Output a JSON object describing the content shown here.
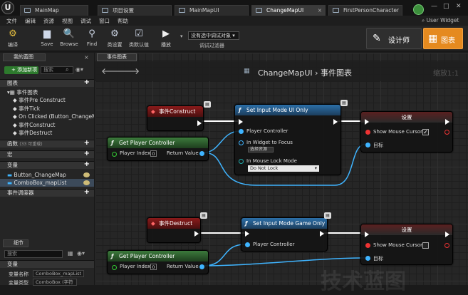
{
  "tabs": [
    {
      "label": "MainMap"
    },
    {
      "label": "项目设置"
    },
    {
      "label": "MainMapUI"
    },
    {
      "label": "ChangeMapUI"
    },
    {
      "label": "FirstPersonCharacter"
    }
  ],
  "menu": [
    "文件",
    "编辑",
    "资源",
    "视图",
    "调试",
    "窗口",
    "帮助"
  ],
  "search_help": "User Widget",
  "toolbar": {
    "compile": "编译",
    "save": "Save",
    "browse": "Browse",
    "find": "Find",
    "class_settings": "类设置",
    "class_defaults": "类默认值",
    "play": "播放",
    "debug_object": "没有选中调试对象",
    "debug_filter": "调试过滤器",
    "designer": "设计师",
    "graph": "图表"
  },
  "left_panel": {
    "tab": "我的蓝图",
    "add_new": "添加新项",
    "search_placeholder": "搜索",
    "graphs_section": "图表",
    "event_graph": "事件图表",
    "events": [
      "事件Pre Construct",
      "事件Tick",
      "On Clicked (Button_ChangeM",
      "事件Construct",
      "事件Destruct"
    ],
    "functions_section": "函数",
    "functions_count": "(33 可重载)",
    "macros_section": "宏",
    "variables_section": "变量",
    "variables": [
      "Button_ChangeMap",
      "ComboBox_mapList"
    ],
    "dispatchers_section": "事件调度器",
    "details_tab": "细节",
    "details_search": "搜索",
    "details_variable_section": "变量",
    "var_name_label": "变量名称",
    "var_name_value": "ComboBox_mapList",
    "var_type_label": "变量类型",
    "var_type_value": "ComboBox (字符"
  },
  "graph": {
    "tab": "事件图表",
    "breadcrumb_root": "ChangeMapUI",
    "breadcrumb_sep": "›",
    "breadcrumb_page": "事件图表",
    "zoom": "缩放1:1",
    "watermark": "技术蓝图"
  },
  "nodes": {
    "event_construct": "事件Construct",
    "get_pc_1": "Get Player Controller",
    "player_index_label": "Player Index",
    "player_index_value": "0",
    "return_value": "Return Value",
    "set_input_ui": "Set Input Mode UI Only",
    "player_controller": "Player Controller",
    "in_widget_to_focus": "In Widget to Focus",
    "select_asset": "选择资源",
    "in_mouse_lock_mode": "In Mouse Lock Mode",
    "do_not_lock": "Do Not Lock",
    "set_1": "设置",
    "show_mouse_cursor": "Show Mouse Cursor",
    "target": "目标",
    "event_destruct": "事件Destruct",
    "set_input_game": "Set Input Mode Game Only",
    "get_pc_2": "Get Player Controller",
    "set_2": "设置"
  },
  "colors": {
    "accent_orange": "#e58a1f",
    "exec_white": "#ffffff",
    "object_pin": "#3fb4ff",
    "bool_pin": "#e33333"
  }
}
